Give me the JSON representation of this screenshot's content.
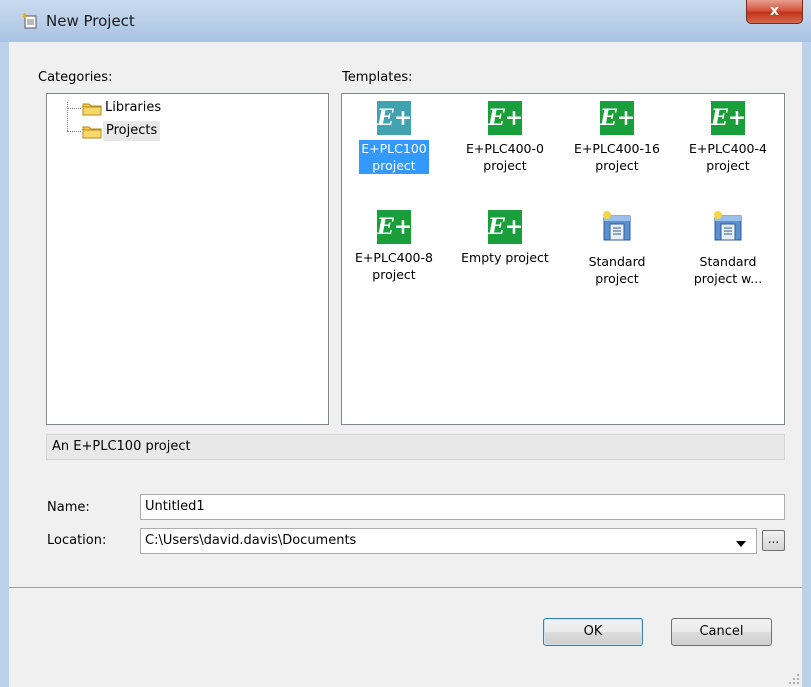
{
  "window": {
    "title": "New Project",
    "close_glyph": "x"
  },
  "categories": {
    "label": "Categories:",
    "items": [
      {
        "label": "Libraries"
      },
      {
        "label": "Projects"
      }
    ]
  },
  "templates": {
    "label": "Templates:",
    "items": [
      {
        "line1": "E+PLC100",
        "line2": "project",
        "icon": "eplus-icon",
        "selected": true
      },
      {
        "line1": "E+PLC400-0",
        "line2": "project",
        "icon": "eplus-icon"
      },
      {
        "line1": "E+PLC400-16",
        "line2": "project",
        "icon": "eplus-icon"
      },
      {
        "line1": "E+PLC400-4",
        "line2": "project",
        "icon": "eplus-icon"
      },
      {
        "line1": "E+PLC400-8",
        "line2": "project",
        "icon": "eplus-icon"
      },
      {
        "line1": "Empty project",
        "line2": "",
        "icon": "eplus-icon"
      },
      {
        "line1": "Standard",
        "line2": "project",
        "icon": "standard-project-icon"
      },
      {
        "line1": "Standard",
        "line2": "project w...",
        "icon": "standard-project-icon"
      }
    ]
  },
  "description": "An E+PLC100 project",
  "name_field": {
    "label": "Name:",
    "value": "Untitled1"
  },
  "location_field": {
    "label": "Location:",
    "value": "C:\\Users\\david.davis\\Documents",
    "browse": "..."
  },
  "buttons": {
    "ok": "OK",
    "cancel": "Cancel"
  },
  "icon_glyph": "E+",
  "colors": {
    "accent": "#3399ff",
    "eplus_green": "#1a9e3a"
  }
}
